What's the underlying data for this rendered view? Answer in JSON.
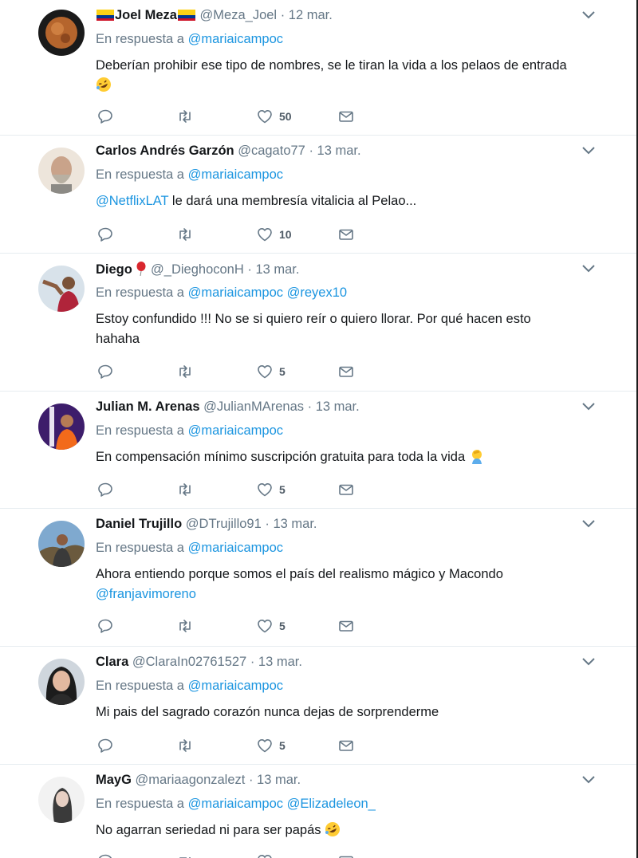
{
  "colors": {
    "link": "#1b95e0",
    "muted": "#657786",
    "text": "#14171a",
    "divider": "#e6ecf0"
  },
  "icons": {
    "reply": "reply-icon",
    "retweet": "retweet-icon",
    "like": "heart-icon",
    "dm": "envelope-icon",
    "more": "chevron-down-icon"
  },
  "tweets": [
    {
      "name": "Joel Meza",
      "handle": "@Meza_Joel",
      "dot": "·",
      "date": "12 mar.",
      "reply_prefix": "En respuesta a ",
      "reply_to": [
        "@mariaicampoc"
      ],
      "text_parts": {
        "t1": "Deberían prohibir ese tipo de nombres, se le tiran la vida a los pelaos de entrada"
      },
      "likes": "50"
    },
    {
      "name": "Carlos Andrés Garzón",
      "handle": "@cagato77",
      "dot": "·",
      "date": "13 mar.",
      "reply_prefix": "En respuesta a ",
      "reply_to": [
        "@mariaicampoc"
      ],
      "text_parts": {
        "mention": "@NetflixLAT",
        "t1": " le dará una membresía vitalicia  al Pelao..."
      },
      "likes": "10"
    },
    {
      "name": "Diego",
      "handle": "@_DieghoconH",
      "dot": "·",
      "date": "13 mar.",
      "reply_prefix": "En respuesta a ",
      "reply_to": [
        "@mariaicampoc",
        "@reyex10"
      ],
      "text_parts": {
        "t1": "Estoy confundido !!! No se si quiero reír o quiero llorar. Por qué hacen esto hahaha"
      },
      "likes": "5"
    },
    {
      "name": "Julian M. Arenas",
      "handle": "@JulianMArenas",
      "dot": "·",
      "date": "13 mar.",
      "reply_prefix": "En respuesta a ",
      "reply_to": [
        "@mariaicampoc"
      ],
      "text_parts": {
        "t1": "En compensación mínimo suscripción gratuita para toda la vida"
      },
      "likes": "5"
    },
    {
      "name": "Daniel Trujillo",
      "handle": "@DTrujillo91",
      "dot": "·",
      "date": "13 mar.",
      "reply_prefix": "En respuesta a ",
      "reply_to": [
        "@mariaicampoc"
      ],
      "text_parts": {
        "t1": "Ahora entiendo porque somos el país del realismo mágico y Macondo",
        "mention": "@franjavimoreno"
      },
      "likes": "5"
    },
    {
      "name": "Clara",
      "handle": "@ClaraIn02761527",
      "dot": "·",
      "date": "13 mar.",
      "reply_prefix": "En respuesta a ",
      "reply_to": [
        "@mariaicampoc"
      ],
      "text_parts": {
        "t1": "Mi pais del sagrado corazón nunca dejas de sorprenderme"
      },
      "likes": "5"
    },
    {
      "name": "MayG",
      "handle": "@mariaagonzalezt",
      "dot": "·",
      "date": "13 mar.",
      "reply_prefix": "En respuesta a ",
      "reply_to": [
        "@mariaicampoc",
        "@Elizadeleon_"
      ],
      "text_parts": {
        "t1": "No agarran seriedad ni para ser papás"
      },
      "likes": ""
    }
  ]
}
